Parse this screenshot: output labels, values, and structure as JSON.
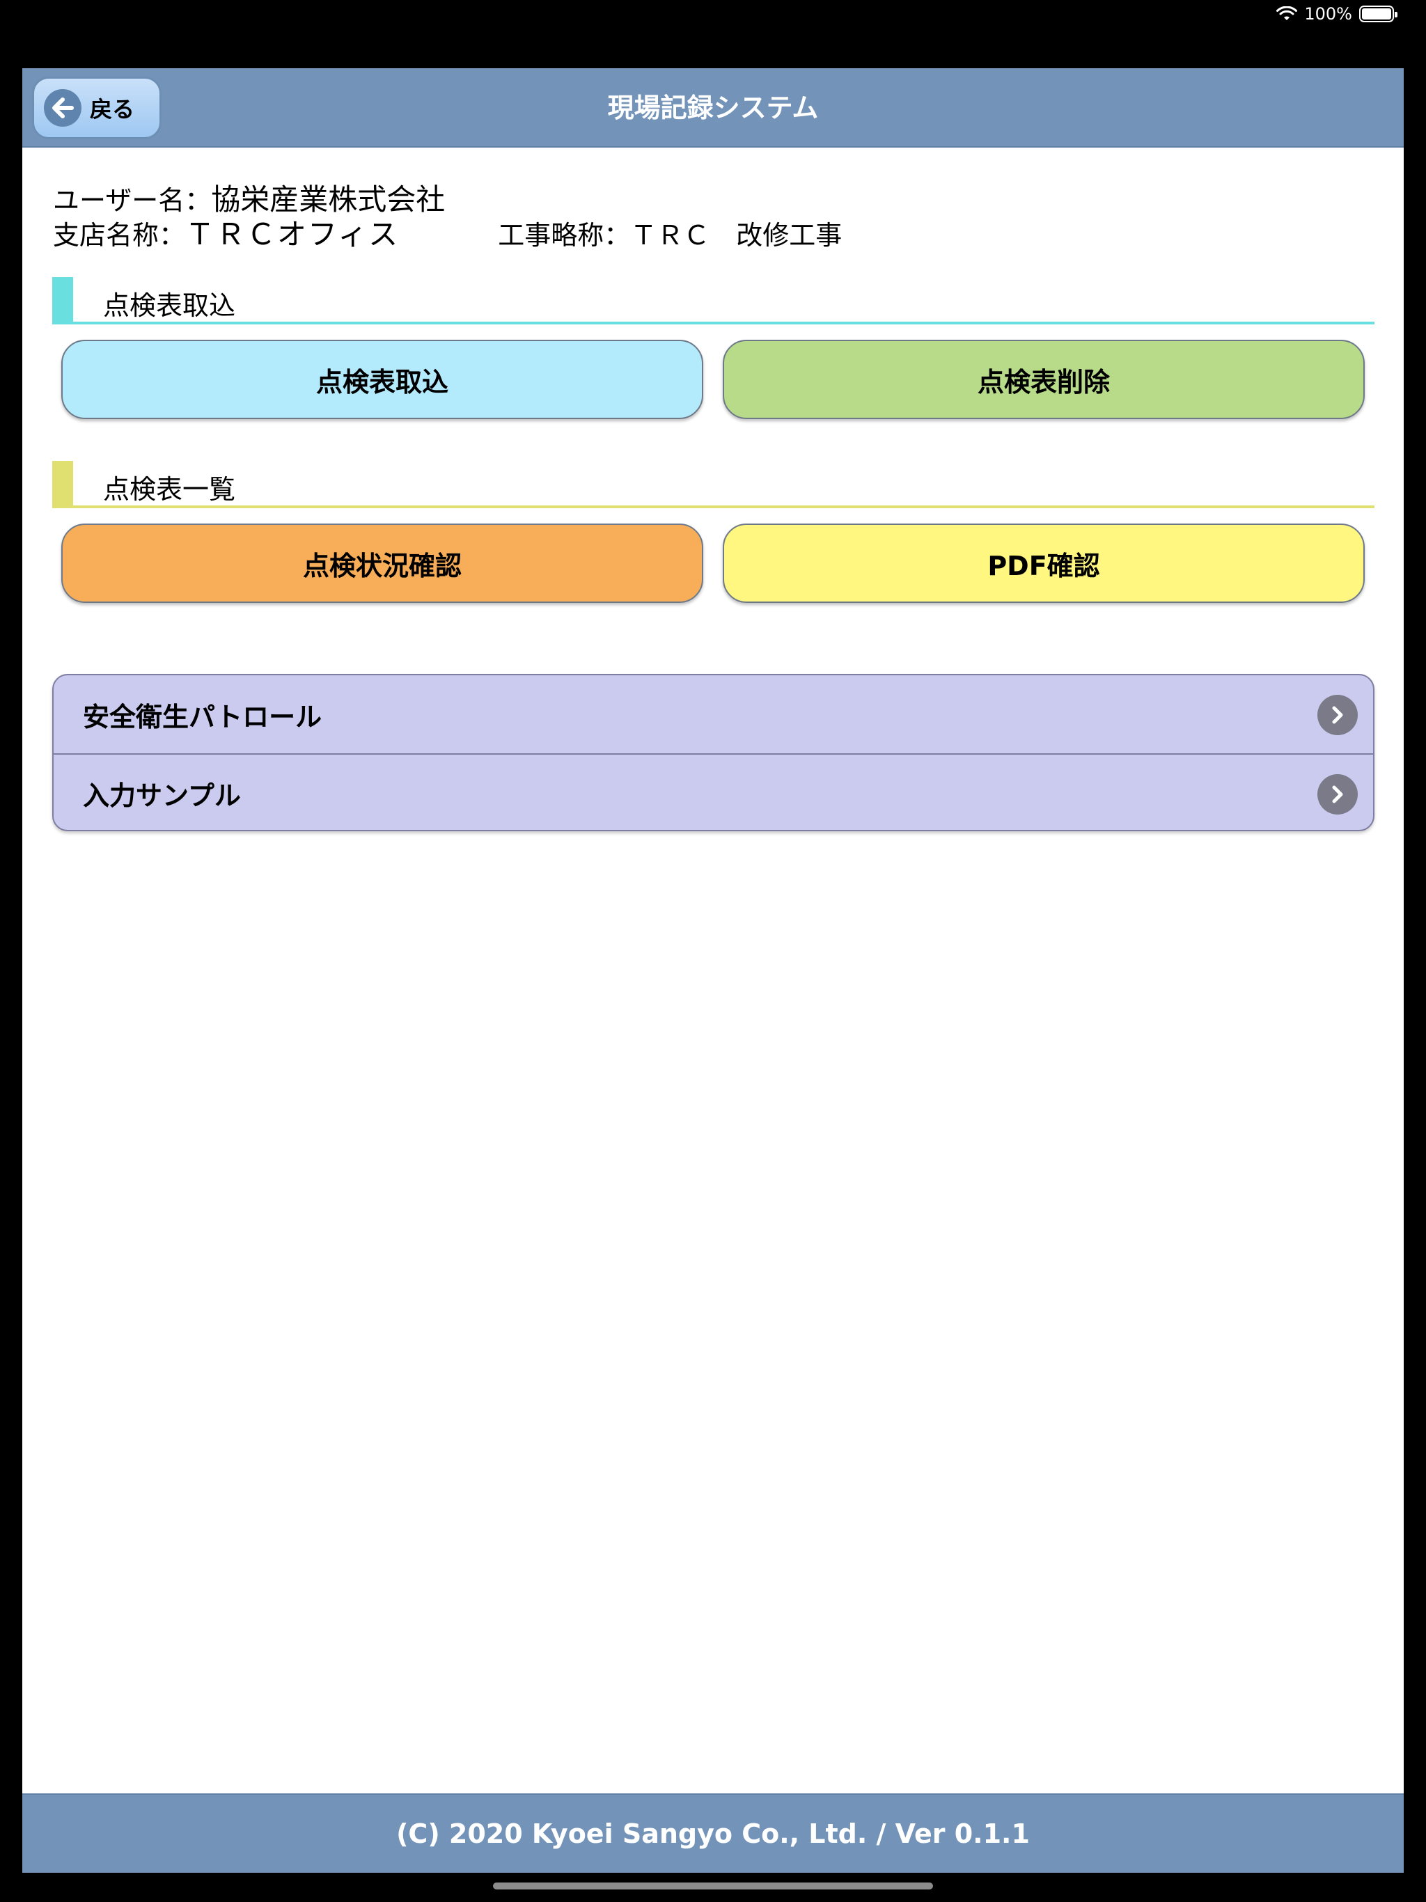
{
  "status_bar": {
    "battery_text": "100%",
    "battery_level": 100
  },
  "header": {
    "back_label": "戻る",
    "title": "現場記録システム"
  },
  "info": {
    "user_label": "ユーザー名：",
    "user_value": "協栄産業株式会社",
    "branch_label": "支店名称：",
    "branch_value": "ＴＲＣオフィス",
    "construction_label": "工事略称：",
    "construction_value": "ＴＲＣ　改修工事"
  },
  "sections": {
    "import": {
      "label": "点検表取込",
      "accent": "#6adfdf",
      "buttons": [
        {
          "label": "点検表取込",
          "color": "#b3ebfc"
        },
        {
          "label": "点検表削除",
          "color": "#b7db88"
        }
      ]
    },
    "list": {
      "label": "点検表一覧",
      "accent": "#e0e070",
      "buttons": [
        {
          "label": "点検状況確認",
          "color": "#f8ae58"
        },
        {
          "label": "PDF確認",
          "color": "#fff77f"
        }
      ]
    }
  },
  "checklists": [
    {
      "label": "安全衛生パトロール"
    },
    {
      "label": "入力サンプル"
    }
  ],
  "footer": {
    "copyright": "(C) 2020 Kyoei Sangyo Co., Ltd. / Ver 0.1.1"
  },
  "icons": {
    "back": "arrow-left-circle-icon",
    "row_chevron": "chevron-right-circle-icon",
    "wifi": "wifi-icon",
    "battery": "battery-icon"
  }
}
